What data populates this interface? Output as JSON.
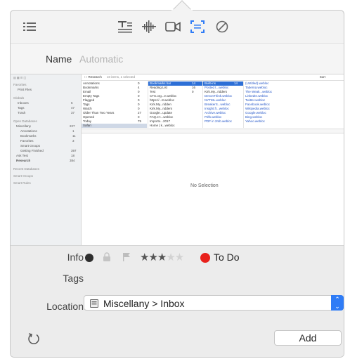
{
  "name": {
    "label": "Name",
    "placeholder": "Automatic"
  },
  "toolbar": {
    "icons": [
      "list-icon",
      "text-format-icon",
      "waveform-icon",
      "video-icon",
      "capture-icon",
      "disabled-icon"
    ]
  },
  "preview": {
    "sidebar": {
      "favorites_header": "Favorites",
      "favorites": [
        "Print Files"
      ],
      "globals_header": "Globals",
      "globals": [
        [
          "Inboxes",
          "6"
        ],
        [
          "Tags",
          "47"
        ],
        [
          "Trash",
          "37"
        ]
      ],
      "open_databases_header": "Open Databases",
      "databases": [
        [
          "Miscellany",
          "227"
        ],
        [
          "Annotations",
          "1"
        ],
        [
          "Bookmarks",
          "11"
        ],
        [
          "Favorites",
          "3"
        ],
        [
          "Smart Groups",
          ""
        ],
        [
          "Getting Finished",
          "397"
        ],
        [
          "Ask Test",
          "18"
        ],
        [
          "Research",
          "384"
        ]
      ],
      "footer": [
        "Recent Databases",
        "Smart Groups",
        "Smart Rules"
      ]
    },
    "header_path": "Research",
    "header_count": "10 items, 1 selected",
    "header_sort": "Sort",
    "col1": [
      [
        "Annotations",
        "0"
      ],
      [
        "Bookmarks",
        "4"
      ],
      [
        "Email",
        "0"
      ],
      [
        "Empty Tags",
        "0"
      ],
      [
        "Flagged",
        "0"
      ],
      [
        "Tags",
        "0"
      ],
      [
        "Watch",
        "0"
      ],
      [
        "Older Than Two Years",
        "27"
      ],
      [
        "Opened",
        "0"
      ],
      [
        "Today",
        "75"
      ],
      [
        "Safari",
        "37"
      ]
    ],
    "col2": [
      [
        "Bookmarks bar",
        "14"
      ],
      [
        "Reading List",
        "16"
      ],
      [
        "Test",
        "0"
      ],
      [
        "CTS.org...e.webloc",
        ""
      ],
      [
        "https://...8.webloc",
        ""
      ],
      [
        "Kirk.My...ridden",
        ""
      ],
      [
        "Kirk.My...ndders",
        ""
      ],
      [
        "Google...update",
        ""
      ],
      [
        "FAQ.e-t...webloc",
        ""
      ],
      [
        "Importo...2017",
        ""
      ],
      [
        "Home | k...webloc",
        ""
      ]
    ],
    "col3": [
      [
        "Built-ins",
        "14"
      ],
      [
        "Posted t...webloc",
        ""
      ],
      [
        "Kirk.My...ridders",
        ""
      ],
      [
        "DevonThink.webloc",
        ""
      ],
      [
        "NYTML.webloc",
        ""
      ],
      [
        "BreakerS...webloc",
        ""
      ],
      [
        "Insight.fr...webloc",
        ""
      ],
      [
        "Archive.webloc",
        ""
      ],
      [
        "Pdfs.webloc",
        ""
      ],
      [
        "PDF in 2mb.webloc",
        ""
      ]
    ],
    "col4": [
      "(Untitled).webloc",
      "Taberna.webloc",
      "The Weak...webloc",
      "LinkedIn.webloc",
      "Twitter.webloc",
      "Facebook.webloc",
      "Wikipedia.webloc",
      "Google.webloc",
      "Bing.webloc",
      "Yahoo.webloc"
    ],
    "no_selection": "No Selection"
  },
  "info": {
    "label": "Info",
    "label_name": "To Do",
    "label_color": "#e8211c",
    "rating": 3,
    "rating_max": 5,
    "stars": "★★★★★"
  },
  "tags": {
    "label": "Tags"
  },
  "location": {
    "label": "Location",
    "value": "Miscellany > Inbox"
  },
  "actions": {
    "add_label": "Add"
  }
}
